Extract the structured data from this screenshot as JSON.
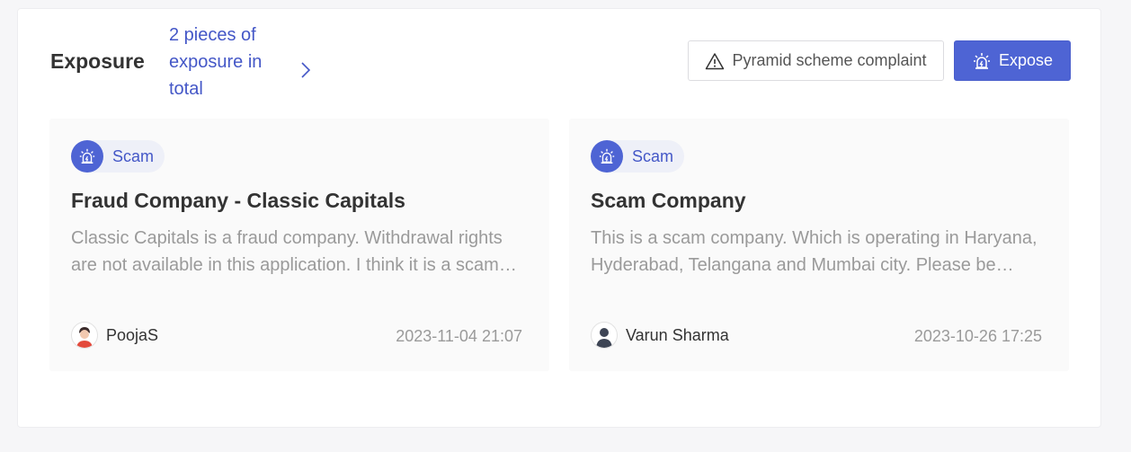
{
  "header": {
    "title": "Exposure",
    "summary_link": "2 pieces of exposure in total",
    "complaint_button": "Pyramid scheme complaint",
    "expose_button": "Expose"
  },
  "icons": {
    "summary_chevron": "chevron-right-icon",
    "complaint": "warning-triangle-icon",
    "expose": "alarm-siren-icon",
    "tag": "alarm-siren-icon"
  },
  "colors": {
    "accent": "#4e64d4",
    "link": "#4457c7"
  },
  "cards": [
    {
      "tag": "Scam",
      "title": "Fraud Company - Classic Capitals",
      "description": "Classic Capitals is a fraud company. Withdrawal rights are not available in this application. I think it is a scam and people should avoid it.",
      "author": "PoojaS",
      "date": "2023-11-04 21:07"
    },
    {
      "tag": "Scam",
      "title": "Scam Company",
      "description": "This is a scam company. Which is operating in Haryana, Hyderabad, Telangana and Mumbai city. Please be careful.",
      "author": "Varun Sharma",
      "date": "2023-10-26 17:25"
    }
  ]
}
